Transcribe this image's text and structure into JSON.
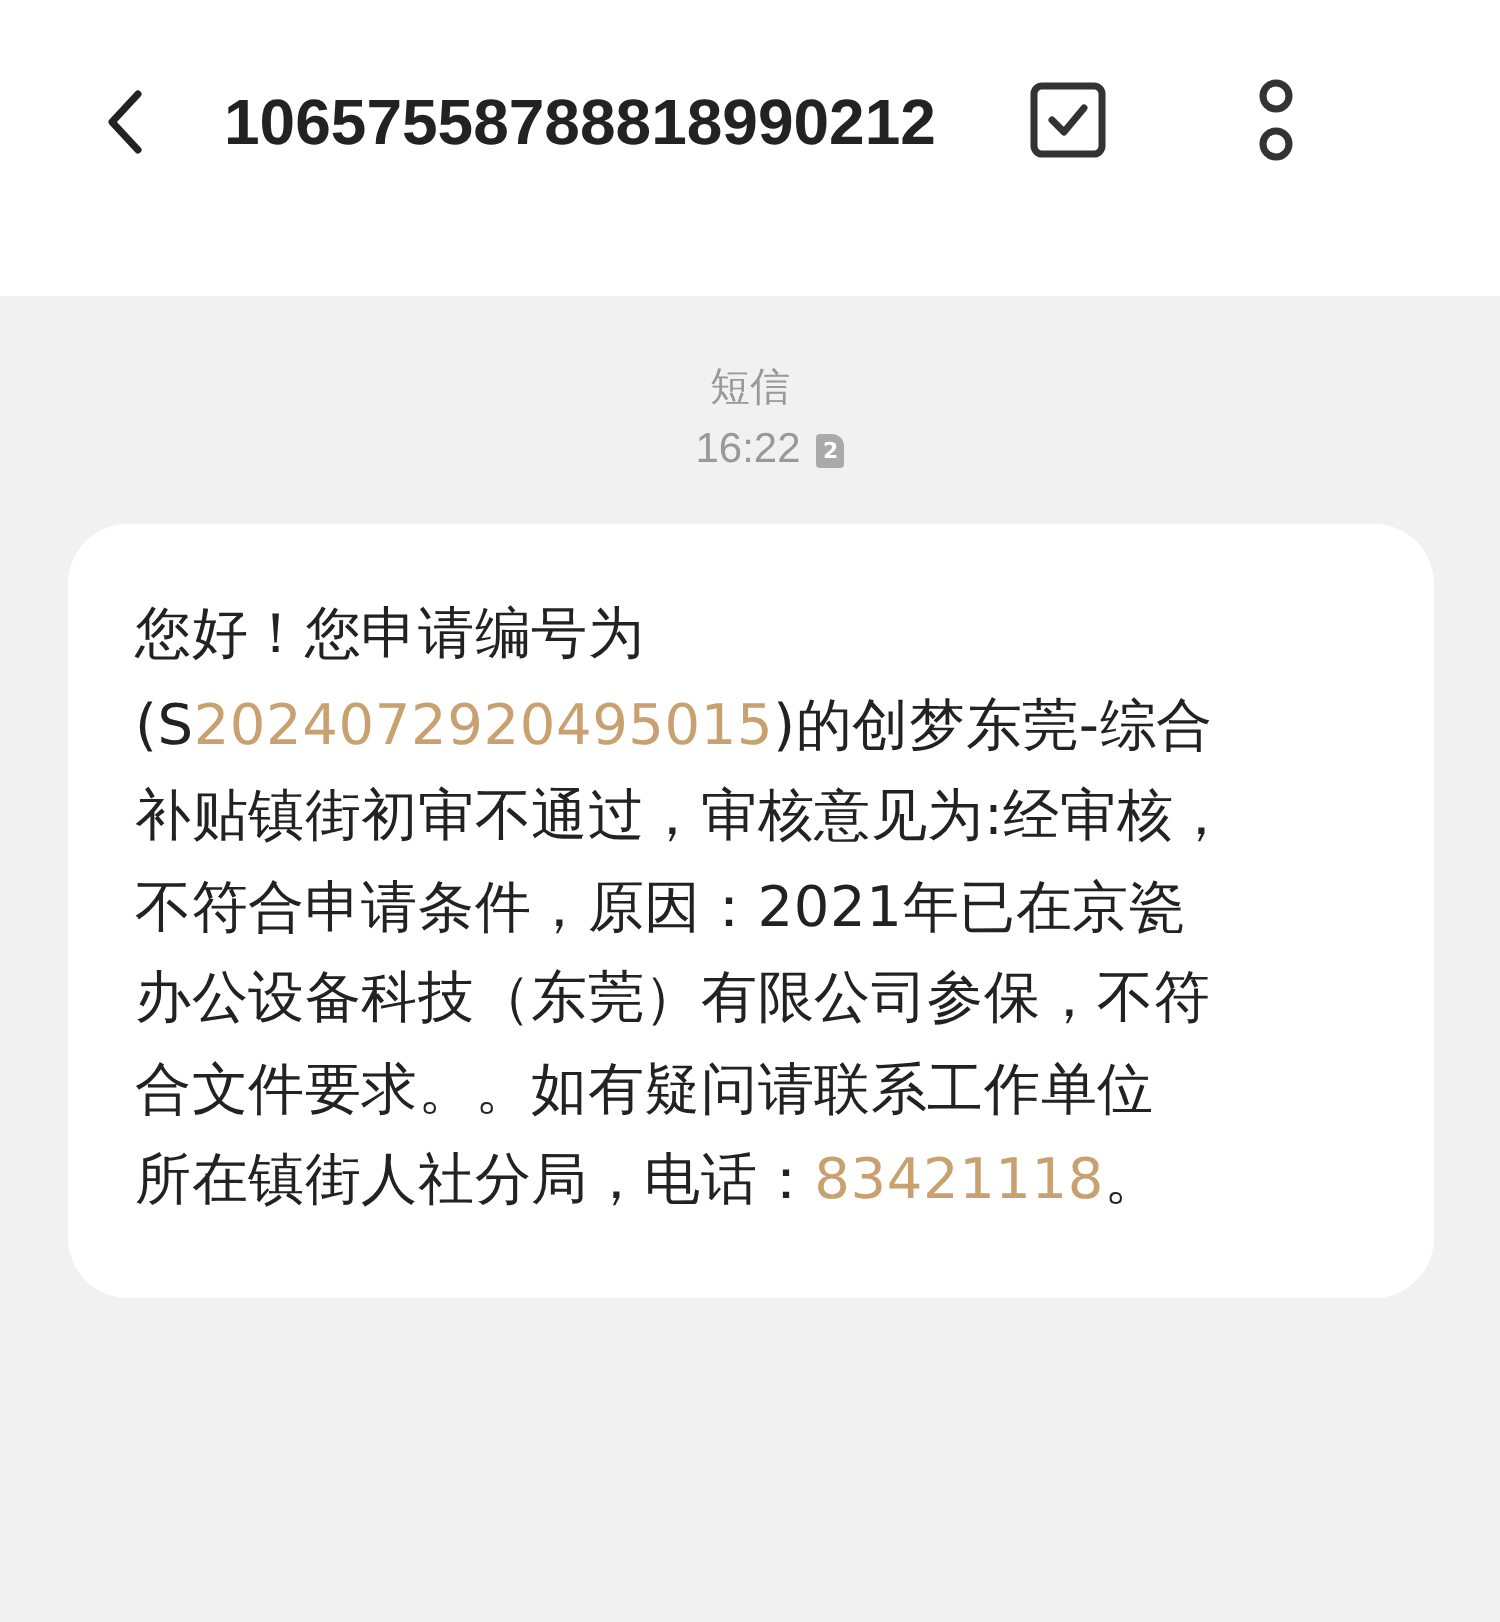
{
  "header": {
    "title": "10657558788818990212"
  },
  "conversation": {
    "label": "短信",
    "time": "16:22",
    "sim": "2"
  },
  "message": {
    "lines": [
      [
        {
          "kind": "plain",
          "text": "您好！您申请编号为"
        }
      ],
      [
        {
          "kind": "plain",
          "text": "(S"
        },
        {
          "kind": "link",
          "text": "2024072920495015"
        },
        {
          "kind": "plain",
          "text": ")的创梦东莞-综合"
        }
      ],
      [
        {
          "kind": "plain",
          "text": "补贴镇街初审不通过，审核意见为:经审核，"
        }
      ],
      [
        {
          "kind": "plain",
          "text": "不符合申请条件，原因：2021年已在京瓷"
        }
      ],
      [
        {
          "kind": "plain",
          "text": "办公设备科技（东莞）有限公司参保，不符"
        }
      ],
      [
        {
          "kind": "plain",
          "text": "合文件要求。。如有疑问请联系工作单位"
        }
      ],
      [
        {
          "kind": "plain",
          "text": "所在镇街人社分局，电话："
        },
        {
          "kind": "link",
          "text": "83421118"
        },
        {
          "kind": "plain",
          "text": "。"
        }
      ]
    ]
  }
}
